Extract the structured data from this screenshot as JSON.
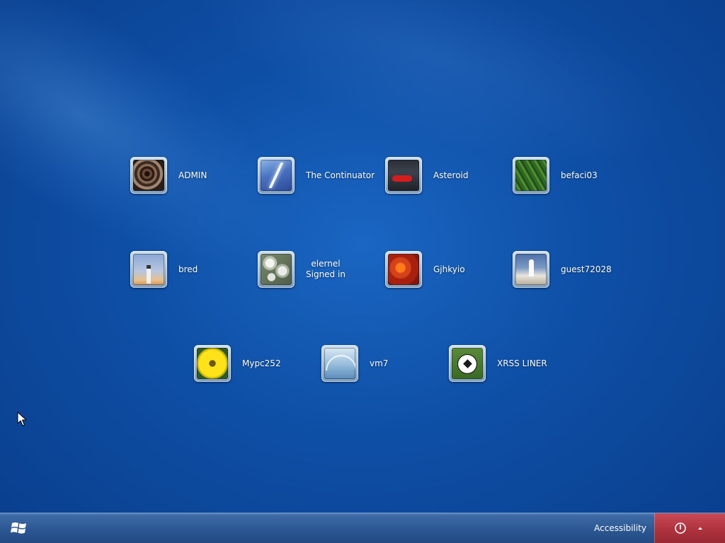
{
  "users": [
    {
      "id": "admin",
      "name": "ADMIN",
      "status": "",
      "picture": "spiral-staircase"
    },
    {
      "id": "the-continuator",
      "name": "The Continuator",
      "status": "",
      "picture": "lightning"
    },
    {
      "id": "asteroid",
      "name": "Asteroid",
      "status": "",
      "picture": "red-car"
    },
    {
      "id": "befaci03",
      "name": "befaci03",
      "status": "",
      "picture": "green-leaf"
    },
    {
      "id": "bred",
      "name": "bred",
      "status": "",
      "picture": "lighthouse"
    },
    {
      "id": "elernel",
      "name": "elernel",
      "status": "Signed in",
      "picture": "white-flowers"
    },
    {
      "id": "gjhkyio",
      "name": "Gjhkyio",
      "status": "",
      "picture": "orange-petals"
    },
    {
      "id": "guest72028",
      "name": "guest72028",
      "status": "",
      "picture": "space-shuttle"
    },
    {
      "id": "mypc252",
      "name": "Mypc252",
      "status": "",
      "picture": "yellow-flower"
    },
    {
      "id": "vm7",
      "name": "vm7",
      "status": "",
      "picture": "architecture-arch"
    },
    {
      "id": "xrss-liner",
      "name": "XRSS LINER",
      "status": "",
      "picture": "soccer-ball"
    }
  ],
  "taskbar": {
    "start_icon": "windows-logo-icon",
    "accessibility_label": "Accessibility",
    "shutdown_icon": "power-icon",
    "shutdown_options_icon": "triangle-up-icon"
  },
  "colors": {
    "background": "#0e4fa6",
    "taskbar": "#2a5590",
    "shutdown_area": "#b0343f",
    "text": "#ffffff"
  }
}
